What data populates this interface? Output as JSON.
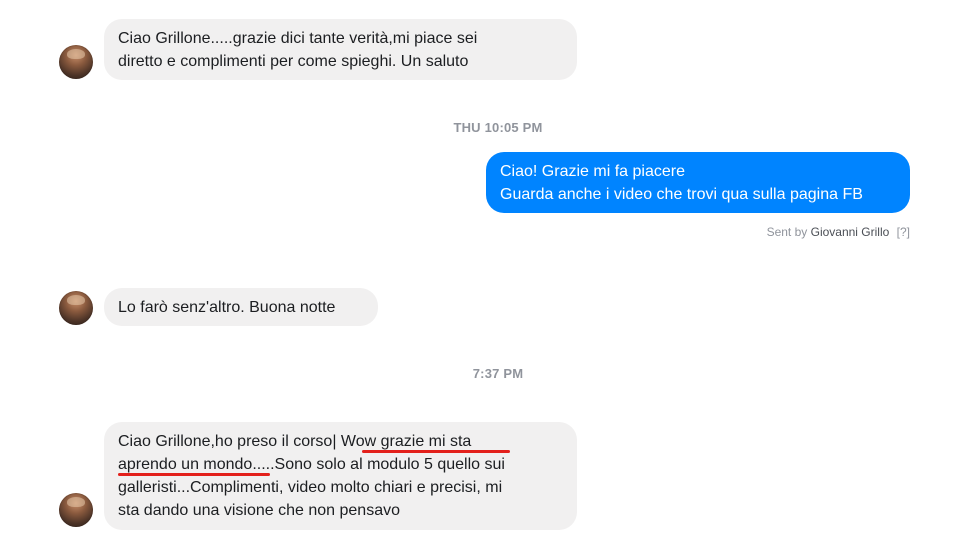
{
  "messages": {
    "m1": {
      "lines": [
        "Ciao Grillone.....grazie dici tante verità,mi piace sei",
        "diretto e complimenti per come spieghi. Un saluto"
      ]
    },
    "timestamp1": "THU 10:05 PM",
    "m2": {
      "lines": [
        "Ciao! Grazie mi fa piacere",
        "Guarda anche i video che trovi qua sulla pagina FB"
      ]
    },
    "sent_by": {
      "prefix": "Sent by",
      "author": "Giovanni Grillo",
      "help": "[?]"
    },
    "m3": {
      "lines": [
        "Lo farò senz'altro. Buona notte"
      ]
    },
    "timestamp2": "7:37 PM",
    "m4": {
      "line1_a": "Ciao Grillone,ho preso il corso| ",
      "line1_b": "Wow grazie mi sta",
      "line2_a": "aprendo un mondo",
      "line2_b": ".....Sono solo al modulo 5 quello sui",
      "line3": "galleristi...Complimenti, video molto chiari e precisi, mi",
      "line4": "sta dando una visione che non pensavo"
    }
  },
  "colors": {
    "incoming_bubble": "#f1f0f0",
    "outgoing_bubble": "#0084ff",
    "highlight_underline": "#e3201b"
  }
}
